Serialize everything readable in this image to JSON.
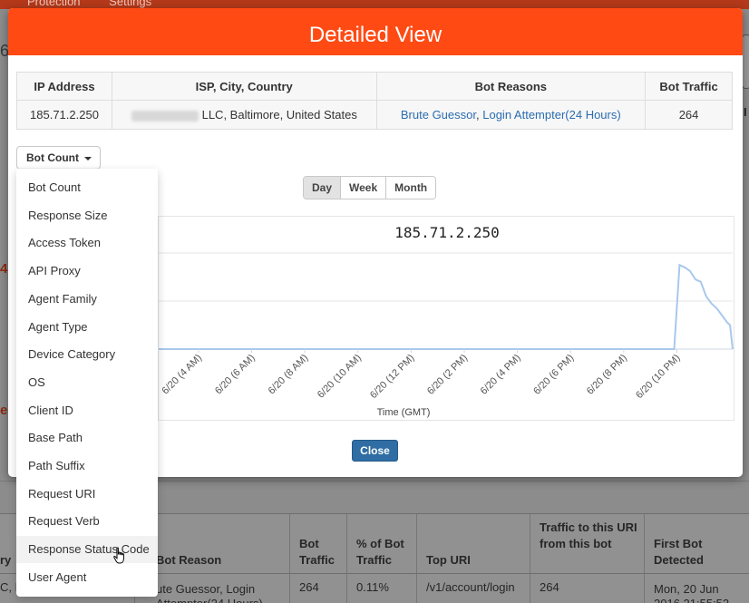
{
  "background": {
    "nav": [
      "Protection",
      "Settings"
    ],
    "digit": "6",
    "red_marks": [
      "4",
      "ee"
    ],
    "right_header": "I",
    "table": {
      "headers": [
        "ry",
        "Bot Reason",
        "Bot Traffic",
        "% of Bot Traffic",
        "Top URI",
        "Traffic to this URI from this bot",
        "First Bot Detected"
      ],
      "row": [
        "C, B",
        "ute Guessor, Login Attempter(24 Hours)",
        "264",
        "0.11%",
        "/v1/account/login",
        "264",
        "Mon, 20 Jun 2016 21:55:52"
      ]
    }
  },
  "modal": {
    "title": "Detailed View",
    "table": {
      "headers": [
        "IP Address",
        "ISP, City, Country",
        "Bot Reasons",
        "Bot Traffic"
      ],
      "row": {
        "ip": "185.71.2.250",
        "location": "LLC, Baltimore, United States",
        "reason_1": "Brute Guessor",
        "reason_sep": ", ",
        "reason_2": "Login Attempter(24 Hours)",
        "traffic": "264"
      }
    },
    "dropdown_label": "Bot Count",
    "ranges": [
      "Day",
      "Week",
      "Month"
    ],
    "close_label": "Close",
    "menu_items": [
      "Bot Count",
      "Response Size",
      "Access Token",
      "API Proxy",
      "Agent Family",
      "Agent Type",
      "Device Category",
      "OS",
      "Client ID",
      "Base Path",
      "Path Suffix",
      "Request URI",
      "Request Verb",
      "Response Status Code",
      "User Agent"
    ],
    "hovered_item": "Response Status Code"
  },
  "chart_data": {
    "type": "line",
    "title": "185.71.2.250",
    "xlabel": "Time (GMT)",
    "x_ticks": [
      "6/20 (4 AM)",
      "6/20 (6 AM)",
      "6/20 (8 AM)",
      "6/20 (10 AM)",
      "6/20 (12 PM)",
      "6/20 (2 PM)",
      "6/20 (4 PM)",
      "6/20 (6 PM)",
      "6/20 (8 PM)",
      "6/20 (10 PM)"
    ],
    "series": [
      {
        "color": "#a9c8ec",
        "x_hours": [
          2.5,
          21.9,
          22.1,
          22.3,
          22.5,
          22.7,
          22.9,
          23.1,
          23.3,
          23.5,
          23.7,
          23.9,
          24.0,
          24.1
        ],
        "values": [
          0,
          0,
          1.75,
          1.7,
          1.62,
          1.45,
          1.4,
          1.1,
          0.95,
          0.85,
          0.7,
          0.55,
          0.5,
          0
        ]
      }
    ],
    "xlim": [
      2.5,
      24.1
    ],
    "ylim": [
      0,
      2
    ],
    "grid": true,
    "line_color": "#a9c8ec"
  }
}
